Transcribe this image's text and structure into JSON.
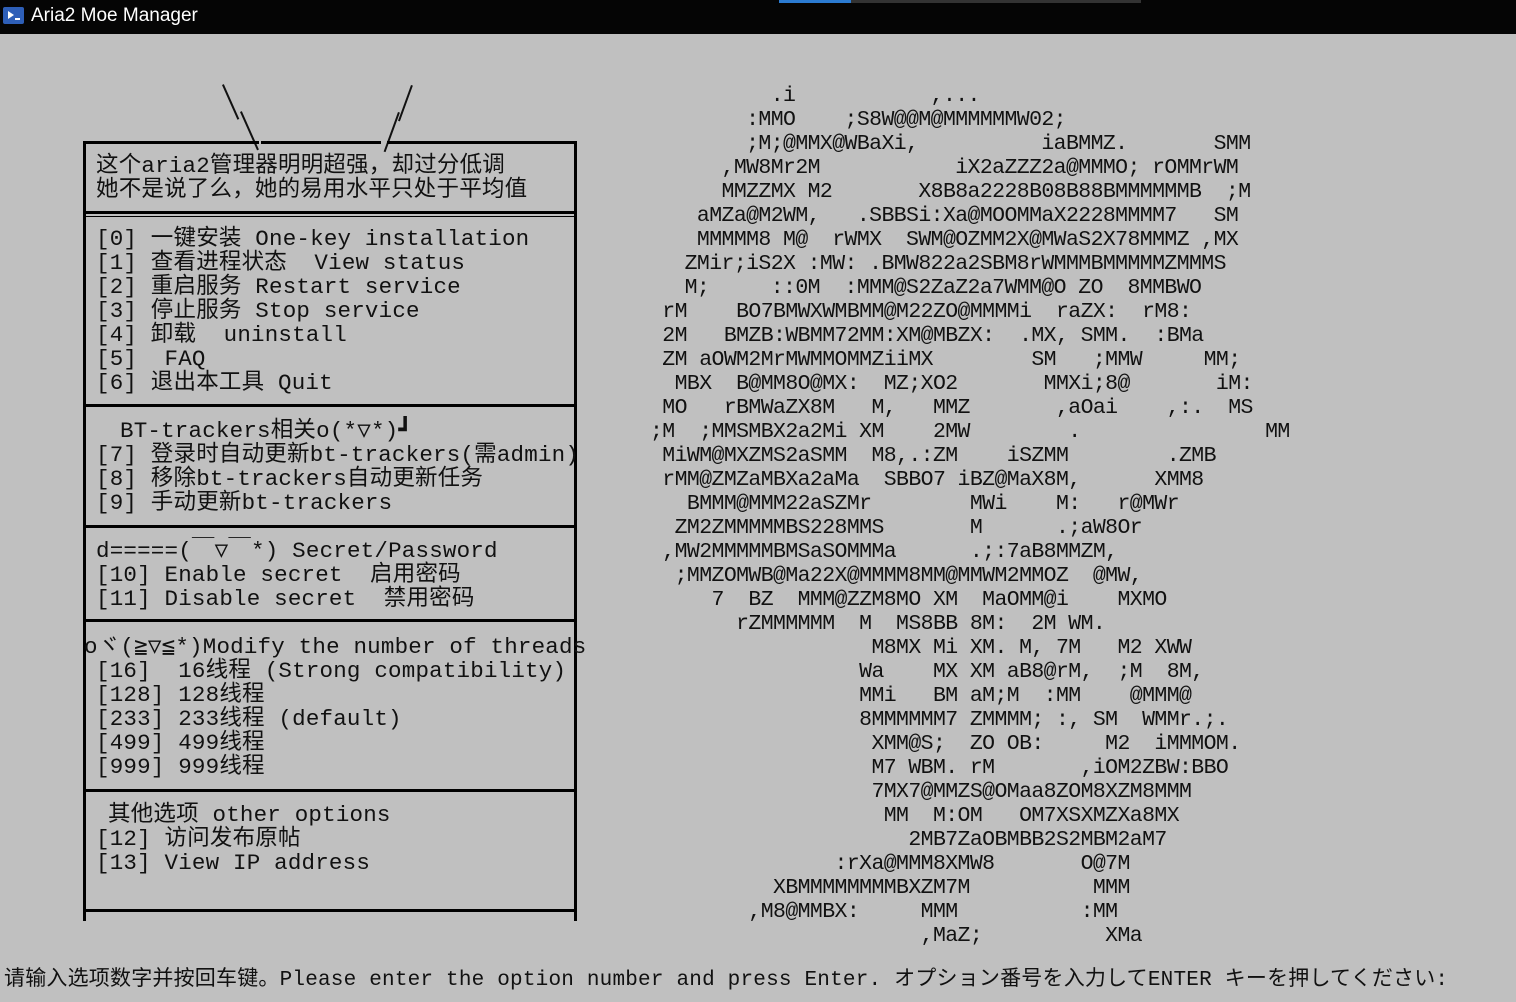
{
  "window": {
    "title": "Aria2 Moe Manager",
    "icon": "powershell-icon"
  },
  "menu": {
    "header": [
      "这个aria2管理器明明超强，却过分低调",
      "她不是说了么，她的易用水平只处于平均值"
    ],
    "main_items": [
      "[0] 一键安装 One-key installation",
      "[1] 查看进程状态  View status",
      "[2] 重启服务 Restart service",
      "[3] 停止服务 Stop service",
      "[4] 卸载  uninstall",
      "[5]  FAQ",
      "[6] 退出本工具 Quit"
    ],
    "bt_heading": "BT-trackers相关o(*▽*)┛",
    "bt_items": [
      "[7] 登录时自动更新bt-trackers(需admin)",
      "[8] 移除bt-trackers自动更新任务",
      "[9] 手动更新bt-trackers"
    ],
    "secret_heading": "d=====(￣▽￣*) Secret/Password",
    "secret_items": [
      "[10] Enable secret  启用密码",
      "[11] Disable secret  禁用密码"
    ],
    "threads_heading": "oヾ(≧▽≦*)Modify the number of threads",
    "threads_items": [
      "[16]  16线程 (Strong compatibility)",
      "[128] 128线程",
      "[233] 233线程 (default)",
      "[499] 499线程",
      "[999] 999线程"
    ],
    "other_heading": "其他选项 other options",
    "other_items": [
      "[12] 访问发布原帖",
      "[13] View IP address"
    ]
  },
  "ascii_art": [
    "         .i           ,...",
    "       :MMO    ;S8W@@M@MMMMMMW02;",
    "       ;M;@MMX@WBaXi,          iaBMMZ.       SMM",
    "     ,MW8Mr2M           iX2aZZZ2a@MMMO; rOMMrWM",
    "     MMZZMX M2       X8B8a2228B08B88BMMMMMMB  ;M",
    "   aMZa@M2WM,   .SBBSi:Xa@MOOMMaX2228MMMM7   SM",
    "   MMMMM8 M@  rWMX  SWM@OZMM2X@MWaS2X78MMMZ ,MX",
    "  ZMir;iS2X :MW: .BMW822a2SBM8rWMMMBMMMMMZMMMS",
    "  M;     ::0M  :MMM@S2ZaZ2a7WMM@O ZO  8MMBWO",
    " rM    BO7BMWXWMBMM@M22ZO@MMMMi  raZX:  rM8:",
    " 2M   BMZB:WBMM72MM:XM@MBZX:  .MX, SMM.  :BMa",
    " ZM aOWM2MrMWMMOMMZiiMX        SM   ;MMW     MM;",
    "  MBX  B@MM8O@MX:  MZ;XO2       MMXi;8@       iM:",
    " MO   rBMWaZX8M   M,   MMZ       ,aOai    ,:.  MS",
    ";M  ;MMSMBX2a2Mi XM    2MW        .               MM",
    " MiWM@MXZMS2aSMM  M8,.:ZM    iSZMM        .ZMB",
    " rMM@ZMZaMBXa2aMa  SBBO7 iBZ@MaX8M,      XMM8",
    "   BMMM@MMM22aSZMr        MWi    M:   r@MWr",
    "  ZM2ZMMMMMBS228MMS       M      .;aW8Or",
    " ,MW2MMMMMBMSaSOMMMa      .;:7aB8MMZM,",
    "  ;MMZOMWB@Ma22X@MMMM8MM@MMWM2MMOZ  @MW,",
    "     7  BZ  MMM@ZZM8MO XM  MaOMM@i    MXMO",
    "       rZMMMMMM  M  MS8BB 8M:  2M WM.",
    "                  M8MX Mi XM. M, 7M   M2 XWW",
    "                 Wa    MX XM aB8@rM,  ;M  8M,",
    "                 MMi   BM aM;M  :MM    @MMM@",
    "                 8MMMMMM7 ZMMMM; :, SM  WMMr.;.",
    "                  XMM@S;  ZO OB:     M2  iMMMOM.",
    "                  M7 WBM. rM       ,iOM2ZBW:BBO",
    "                  7MX7@MMZS@OMaa8ZOM8XZM8MMM",
    "                   MM  M:OM   OM7XSXMZXa8MX",
    "                     2MB7ZaOBMBB2S2MBM2aM7",
    "               :rXa@MMM8XMW8       O@7M",
    "          XBMMMMMMMMBXZM7M          MMM",
    "        ,M8@MMBX:     MMM          :MM",
    "                      ,MaZ;          XMa"
  ],
  "prompt": "请输入选项数字并按回车键。Please enter the option number and press Enter. オプション番号を入力してENTER キーを押してください:"
}
